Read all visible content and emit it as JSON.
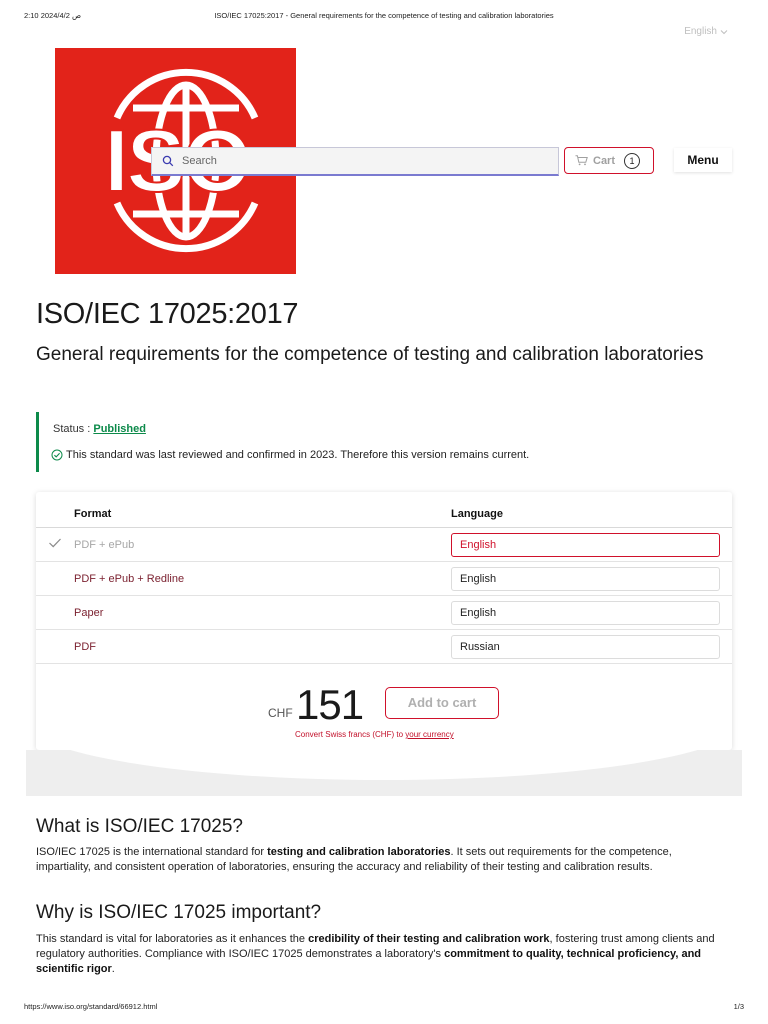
{
  "print_header": {
    "datetime": "2:10 ص 2024/4/2",
    "page_title": "ISO/IEC 17025:2017 - General requirements for the competence of testing and calibration laboratories"
  },
  "language_switch": {
    "label": "English"
  },
  "logo": {
    "text": "ISO",
    "color": "#e2231a"
  },
  "search": {
    "placeholder": "Search",
    "value": ""
  },
  "cart": {
    "label": "Cart",
    "count": "1"
  },
  "menu": {
    "label": "Menu"
  },
  "standard": {
    "title": "ISO/IEC 17025:2017",
    "subtitle": "General requirements for the competence of testing and calibration laboratories"
  },
  "status": {
    "label": "Status : ",
    "value": "Published",
    "note": "This standard was last reviewed and confirmed in 2023. Therefore this version remains current."
  },
  "formats_table": {
    "headers": {
      "format": "Format",
      "language": "Language"
    },
    "rows": [
      {
        "format": "PDF + ePub",
        "language": "English",
        "selected": true
      },
      {
        "format": "PDF + ePub + Redline",
        "language": "English",
        "selected": false
      },
      {
        "format": "Paper",
        "language": "English",
        "selected": false
      },
      {
        "format": "PDF",
        "language": "Russian",
        "selected": false
      }
    ]
  },
  "price": {
    "currency": "CHF",
    "amount": "151",
    "add_to_cart": "Add to cart",
    "convert_text": "Convert Swiss francs (CHF) to ",
    "convert_link": "your currency"
  },
  "sections": {
    "what": {
      "heading": "What is ISO/IEC 17025?",
      "p1": "ISO/IEC 17025 is the international standard for ",
      "b1": "testing and calibration laboratories",
      "p2": ". It sets out requirements for the competence, impartiality, and consistent operation of laboratories, ensuring the accuracy and reliability of their testing and calibration results."
    },
    "why": {
      "heading": "Why is ISO/IEC 17025 important?",
      "p1": "This standard is vital for laboratories as it enhances the ",
      "b1": "credibility of their testing and calibration work",
      "p2": ", fostering trust among clients and regulatory authorities. Compliance with ISO/IEC 17025 demonstrates a laboratory's ",
      "b2": "commitment to quality, technical proficiency, and scientific rigor",
      "p3": "."
    }
  },
  "print_footer": {
    "url": "https://www.iso.org/standard/66912.html",
    "page": "1/3"
  },
  "colors": {
    "brand_red": "#e2231a",
    "accent_red": "#d0112b",
    "status_green": "#0c8a4a"
  }
}
